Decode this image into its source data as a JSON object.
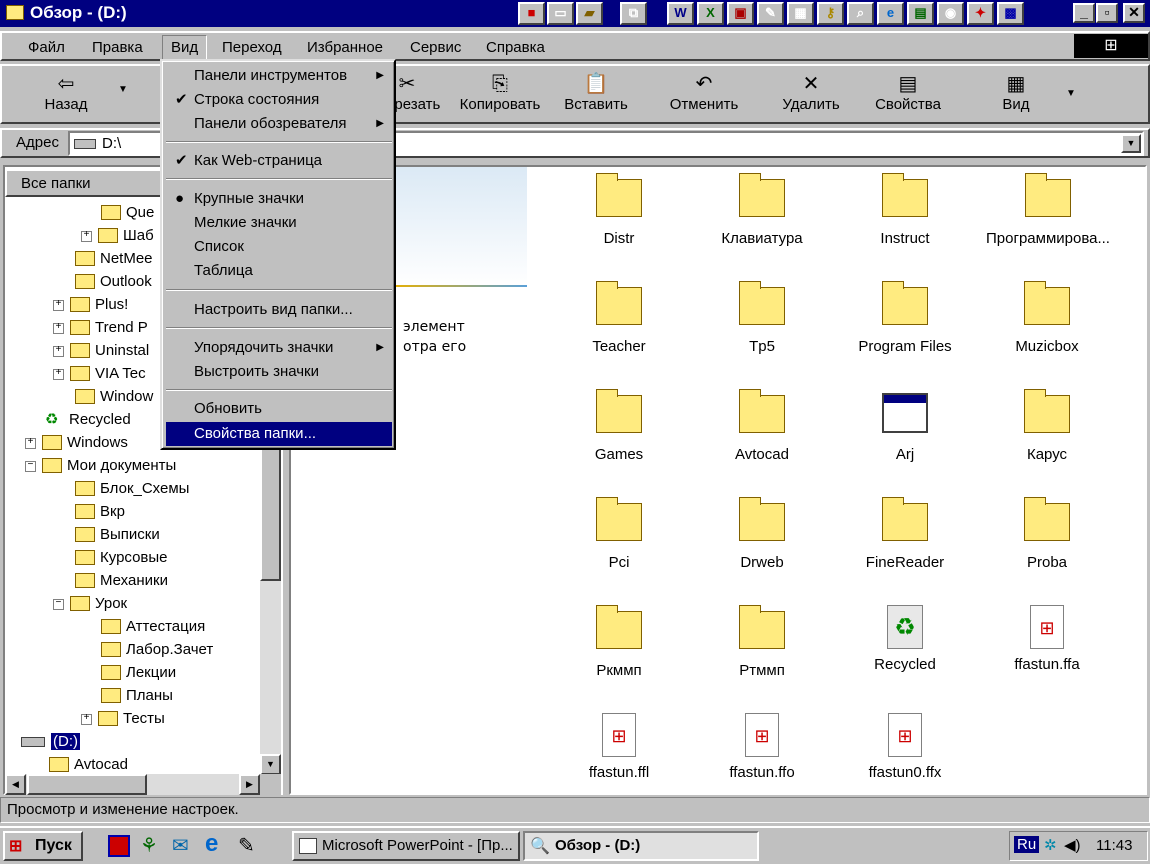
{
  "window": {
    "title": "Обзор -  (D:)"
  },
  "menubar": [
    "Файл",
    "Правка",
    "Вид",
    "Переход",
    "Избранное",
    "Сервис",
    "Справка"
  ],
  "toolbar": {
    "back": "Назад",
    "cut": "Вырезать",
    "copy": "Копировать",
    "paste": "Вставить",
    "undo": "Отменить",
    "delete": "Удалить",
    "properties": "Свойства",
    "view": "Вид"
  },
  "address": {
    "label": "Адрес",
    "value": "D:\\"
  },
  "leftpane": {
    "header": "Все папки",
    "tree": [
      "Que",
      "Шаб",
      "NetMee",
      "Outlook",
      "Plus!",
      "Trend P",
      "Uninstal",
      "VIA Tec",
      "Window",
      "Recycled",
      "Windows",
      "Мои документы",
      "Блок_Схемы",
      "Вкр",
      "Выписки",
      "Курсовые",
      "Механики",
      "Урок",
      "Аттестация",
      "Лабор.Зачет",
      "Лекции",
      "Планы",
      "Тесты",
      "(D:)",
      "Avtocad"
    ]
  },
  "view_menu": {
    "items": [
      "Панели инструментов",
      "Строка состояния",
      "Панели обозревателя",
      "Как Web-страница",
      "Крупные значки",
      "Мелкие значки",
      "Список",
      "Таблица",
      "Настроить вид папки...",
      "Упорядочить значки",
      "Выстроить значки",
      "Обновить",
      "Свойства папки..."
    ]
  },
  "webview": {
    "line1": "элемент",
    "line2": "отра его"
  },
  "files": [
    "Distr",
    "Клавиатура",
    "Instruct",
    "Программирова...",
    "Teacher",
    "Tp5",
    "Program Files",
    "Muzicbox",
    "Games",
    "Avtocad",
    "Arj",
    "Карус",
    "Pci",
    "Drweb",
    "FineReader",
    "Proba",
    "Ркммп",
    "Ртммп",
    "Recycled",
    "ffastun.ffa",
    "ffastun.ffl",
    "ffastun.ffo",
    "ffastun0.ffx"
  ],
  "status": {
    "text": "Просмотр и изменение настроек."
  },
  "taskbar": {
    "start": "Пуск",
    "task1": "Microsoft PowerPoint - [Пр...",
    "task2": "Обзор -  (D:)",
    "lang": "Ru",
    "clock": "11:43"
  },
  "colors": {
    "titlebar": "#000080",
    "face": "#c0c0c0",
    "highlight": "#000080"
  }
}
